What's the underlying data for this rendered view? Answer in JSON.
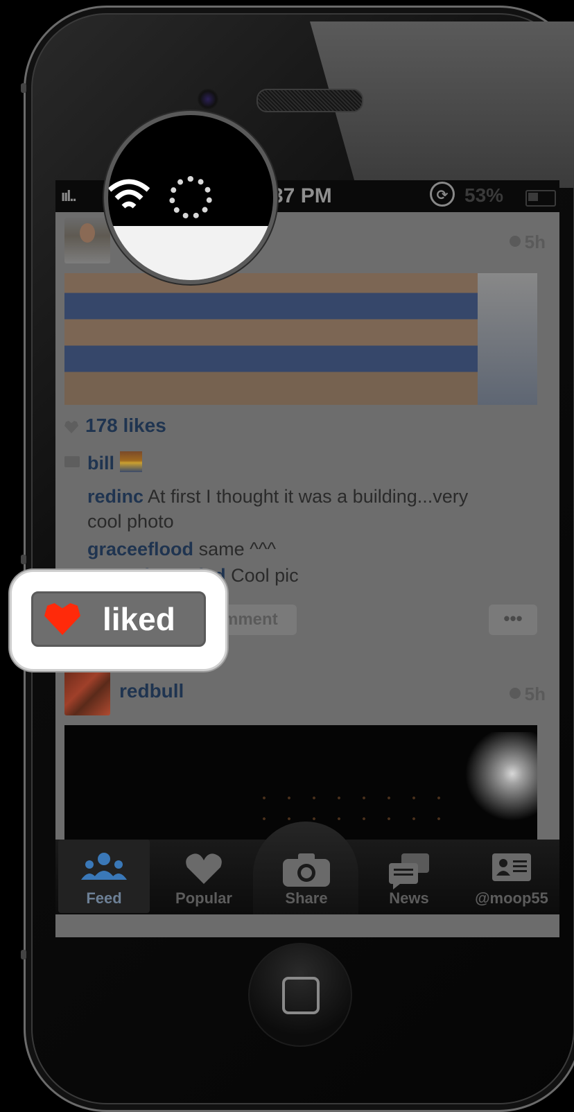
{
  "status_bar": {
    "signal": "ııl..",
    "time": ":37 PM",
    "battery": "53%"
  },
  "post1": {
    "time": "5h",
    "likes": "178 likes",
    "caption_user": "bill",
    "comments": [
      {
        "user": "redinc",
        "text": "At first I thought it was a building...very cool photo"
      },
      {
        "user": "graceeflood",
        "text": "same ^^^"
      },
      {
        "user": "morenitaenvied",
        "text": "Cool pic"
      }
    ],
    "comment_button": "mment",
    "more_button": "•••"
  },
  "post2": {
    "username": "redbull",
    "time": "5h"
  },
  "tabs": [
    {
      "label": "Feed",
      "icon": "people-icon"
    },
    {
      "label": "Popular",
      "icon": "heart-icon"
    },
    {
      "label": "Share",
      "icon": "camera-icon"
    },
    {
      "label": "News",
      "icon": "speech-bubbles-icon"
    },
    {
      "label": "@moop55",
      "icon": "profile-card-icon"
    }
  ],
  "liked_badge": {
    "label": "liked"
  },
  "colors": {
    "username": "#1f3450",
    "liked_heart": "#ff2a0a",
    "active_tab": "#3a78b8"
  }
}
